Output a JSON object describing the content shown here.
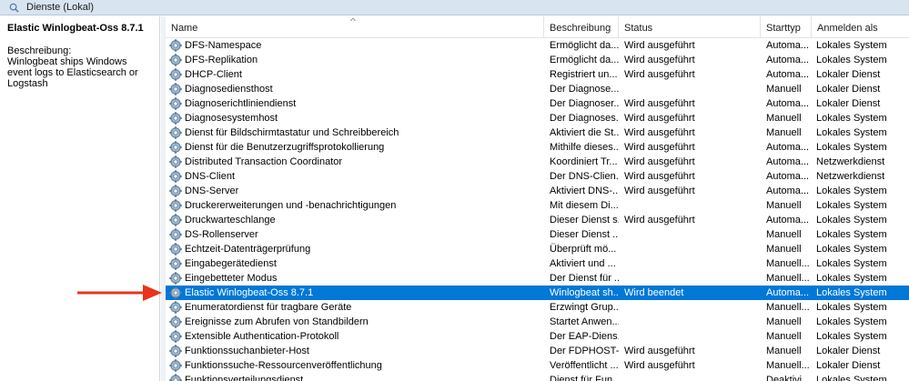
{
  "window": {
    "title": "Dienste (Lokal)"
  },
  "left_pane": {
    "service_name": "Elastic Winlogbeat-Oss 8.7.1",
    "description_label": "Beschreibung:",
    "description_text": "Winlogbeat ships Windows event logs to Elasticsearch or Logstash"
  },
  "columns": {
    "name": "Name",
    "description": "Beschreibung",
    "status": "Status",
    "startup": "Starttyp",
    "logon": "Anmelden als"
  },
  "services": [
    {
      "name": "DFS-Namespace",
      "description": "Ermöglicht da...",
      "status": "Wird ausgeführt",
      "startup": "Automa...",
      "logon": "Lokales System"
    },
    {
      "name": "DFS-Replikation",
      "description": "Ermöglicht da...",
      "status": "Wird ausgeführt",
      "startup": "Automa...",
      "logon": "Lokales System"
    },
    {
      "name": "DHCP-Client",
      "description": "Registriert un...",
      "status": "Wird ausgeführt",
      "startup": "Automa...",
      "logon": "Lokaler Dienst"
    },
    {
      "name": "Diagnosediensthost",
      "description": "Der Diagnose...",
      "status": "",
      "startup": "Manuell",
      "logon": "Lokaler Dienst"
    },
    {
      "name": "Diagnoserichtliniendienst",
      "description": "Der Diagnoser...",
      "status": "Wird ausgeführt",
      "startup": "Automa...",
      "logon": "Lokaler Dienst"
    },
    {
      "name": "Diagnosesystemhost",
      "description": "Der Diagnoses...",
      "status": "Wird ausgeführt",
      "startup": "Manuell",
      "logon": "Lokales System"
    },
    {
      "name": "Dienst für Bildschirmtastatur und Schreibbereich",
      "description": "Aktiviert die St...",
      "status": "Wird ausgeführt",
      "startup": "Manuell",
      "logon": "Lokales System"
    },
    {
      "name": "Dienst für die Benutzerzugriffsprotokollierung",
      "description": "Mithilfe dieses...",
      "status": "Wird ausgeführt",
      "startup": "Automa...",
      "logon": "Lokales System"
    },
    {
      "name": "Distributed Transaction Coordinator",
      "description": "Koordiniert Tr...",
      "status": "Wird ausgeführt",
      "startup": "Automa...",
      "logon": "Netzwerkdienst"
    },
    {
      "name": "DNS-Client",
      "description": "Der DNS-Clien...",
      "status": "Wird ausgeführt",
      "startup": "Automa...",
      "logon": "Netzwerkdienst"
    },
    {
      "name": "DNS-Server",
      "description": "Aktiviert DNS-...",
      "status": "Wird ausgeführt",
      "startup": "Automa...",
      "logon": "Lokales System"
    },
    {
      "name": "Druckererweiterungen und -benachrichtigungen",
      "description": "Mit diesem Di...",
      "status": "",
      "startup": "Manuell",
      "logon": "Lokales System"
    },
    {
      "name": "Druckwarteschlange",
      "description": "Dieser Dienst s...",
      "status": "Wird ausgeführt",
      "startup": "Automa...",
      "logon": "Lokales System"
    },
    {
      "name": "DS-Rollenserver",
      "description": "Dieser Dienst ...",
      "status": "",
      "startup": "Manuell",
      "logon": "Lokales System"
    },
    {
      "name": "Echtzeit-Datenträgerprüfung",
      "description": "Überprüft mö...",
      "status": "",
      "startup": "Manuell",
      "logon": "Lokales System"
    },
    {
      "name": "Eingabegerätedienst",
      "description": "Aktiviert und ...",
      "status": "",
      "startup": "Manuell...",
      "logon": "Lokales System"
    },
    {
      "name": "Eingebetteter Modus",
      "description": "Der Dienst für ...",
      "status": "",
      "startup": "Manuell...",
      "logon": "Lokales System"
    },
    {
      "name": "Elastic Winlogbeat-Oss 8.7.1",
      "description": "Winlogbeat sh...",
      "status": "Wird beendet",
      "startup": "Automa...",
      "logon": "Lokales System",
      "selected": true
    },
    {
      "name": "Enumeratordienst für tragbare Geräte",
      "description": "Erzwingt Grup...",
      "status": "",
      "startup": "Manuell...",
      "logon": "Lokales System"
    },
    {
      "name": "Ereignisse zum Abrufen von Standbildern",
      "description": "Startet Anwen...",
      "status": "",
      "startup": "Manuell",
      "logon": "Lokales System"
    },
    {
      "name": "Extensible Authentication-Protokoll",
      "description": "Der EAP-Diens...",
      "status": "",
      "startup": "Manuell",
      "logon": "Lokales System"
    },
    {
      "name": "Funktionssuchanbieter-Host",
      "description": "Der FDPHOST-...",
      "status": "Wird ausgeführt",
      "startup": "Manuell",
      "logon": "Lokaler Dienst"
    },
    {
      "name": "Funktionssuche-Ressourcenveröffentlichung",
      "description": "Veröffentlicht ...",
      "status": "Wird ausgeführt",
      "startup": "Manuell...",
      "logon": "Lokaler Dienst"
    },
    {
      "name": "Funktionsverteilungsdienst",
      "description": "Dienst für Fun...",
      "status": "",
      "startup": "Deaktivi...",
      "logon": "Lokales System"
    }
  ],
  "colors": {
    "selection": "#0078d7",
    "arrow": "#e8341c"
  },
  "icons": {
    "title": "services-icon",
    "row": "gear-icon",
    "annotation": "red-arrow"
  }
}
